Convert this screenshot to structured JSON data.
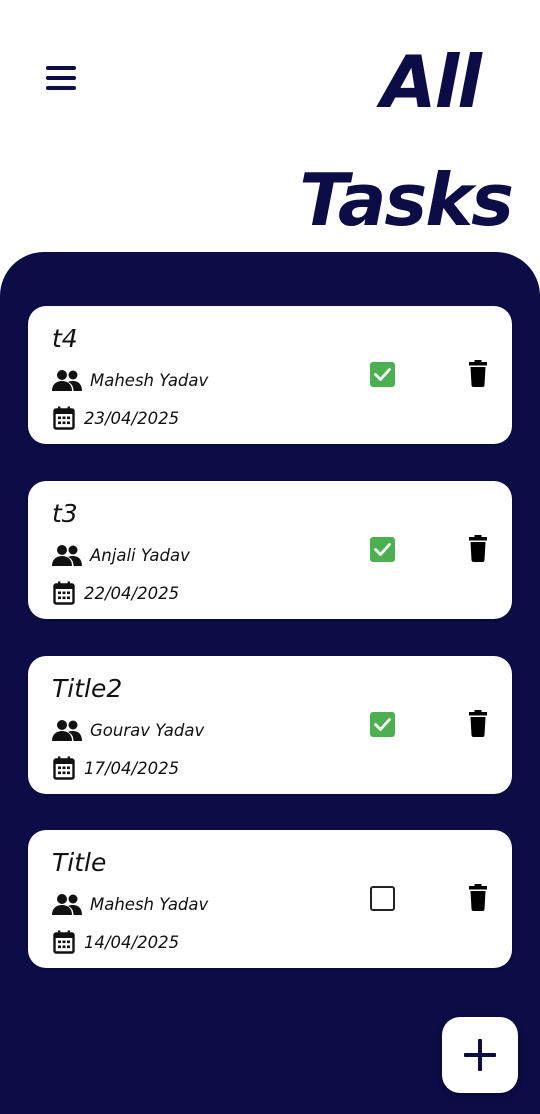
{
  "header": {
    "menu_icon": "hamburger-menu-icon",
    "title_line1": "All",
    "title_line2": "Tasks"
  },
  "colors": {
    "navy": "#0c0c46",
    "check_green": "#4caf50",
    "card_bg": "#ffffff"
  },
  "tasks": [
    {
      "title": "t4",
      "assignee": "Mahesh Yadav",
      "date": "23/04/2025",
      "completed": true
    },
    {
      "title": "t3",
      "assignee": "Anjali Yadav",
      "date": "22/04/2025",
      "completed": true
    },
    {
      "title": "Title2",
      "assignee": "Gourav Yadav",
      "date": "17/04/2025",
      "completed": true
    },
    {
      "title": "Title",
      "assignee": "Mahesh Yadav",
      "date": "14/04/2025",
      "completed": false
    }
  ],
  "icons": {
    "assignee": "people-icon",
    "date": "calendar-icon",
    "delete": "trash-icon",
    "add": "plus-icon"
  }
}
